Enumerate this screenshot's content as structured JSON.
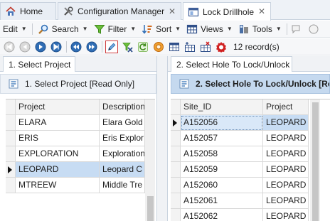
{
  "doc_tabs": [
    {
      "label": "Home",
      "icon": "home-icon",
      "active": false,
      "closable": false
    },
    {
      "label": "Configuration Manager",
      "icon": "tools-icon",
      "active": false,
      "closable": true
    },
    {
      "label": "Lock Drillhole",
      "icon": "window-icon",
      "active": true,
      "closable": true
    }
  ],
  "menubar": {
    "edit": "Edit",
    "search": "Search",
    "filter": "Filter",
    "sort": "Sort",
    "views": "Views",
    "tools": "Tools"
  },
  "navbar": {
    "buttons": [
      "first-record-icon",
      "previous-record-icon",
      "next-record-icon",
      "last-record-icon",
      "first-page-icon",
      "next-page-icon",
      "edit-pencil-icon",
      "clear-filter-icon",
      "refresh-icon",
      "options-gear-icon",
      "grid-layout-icon",
      "grid-add-icon",
      "grid-remove-icon",
      "record-badge-icon"
    ],
    "record_count": "12 record(s)"
  },
  "left_panel": {
    "tab": "1. Select Project",
    "header": "1. Select Project [Read Only]",
    "columns": [
      "Project",
      "Description"
    ],
    "rows": [
      [
        "ELARA",
        "Elara Gold"
      ],
      [
        "ERIS",
        "Eris Explor"
      ],
      [
        "EXPLORATION",
        "Exploration"
      ],
      [
        "LEOPARD",
        "Leopard C"
      ],
      [
        "MTREEW",
        "Middle Tre"
      ]
    ],
    "selected_index": 3
  },
  "right_panel": {
    "tab": "2. Select Hole To Lock/Unlock",
    "header": "2. Select Hole To Lock/Unlock [Re",
    "columns": [
      "Site_ID",
      "Project"
    ],
    "rows": [
      [
        "A152056",
        "LEOPARD"
      ],
      [
        "A152057",
        "LEOPARD"
      ],
      [
        "A152058",
        "LEOPARD"
      ],
      [
        "A152059",
        "LEOPARD"
      ],
      [
        "A152060",
        "LEOPARD"
      ],
      [
        "A152061",
        "LEOPARD"
      ],
      [
        "A152062",
        "LEOPARD"
      ]
    ],
    "selected_index": 0
  },
  "colors": {
    "selection": "#c7dcf3",
    "header_highlight": "#c5d9ef",
    "chrome": "#f6f7f9"
  }
}
